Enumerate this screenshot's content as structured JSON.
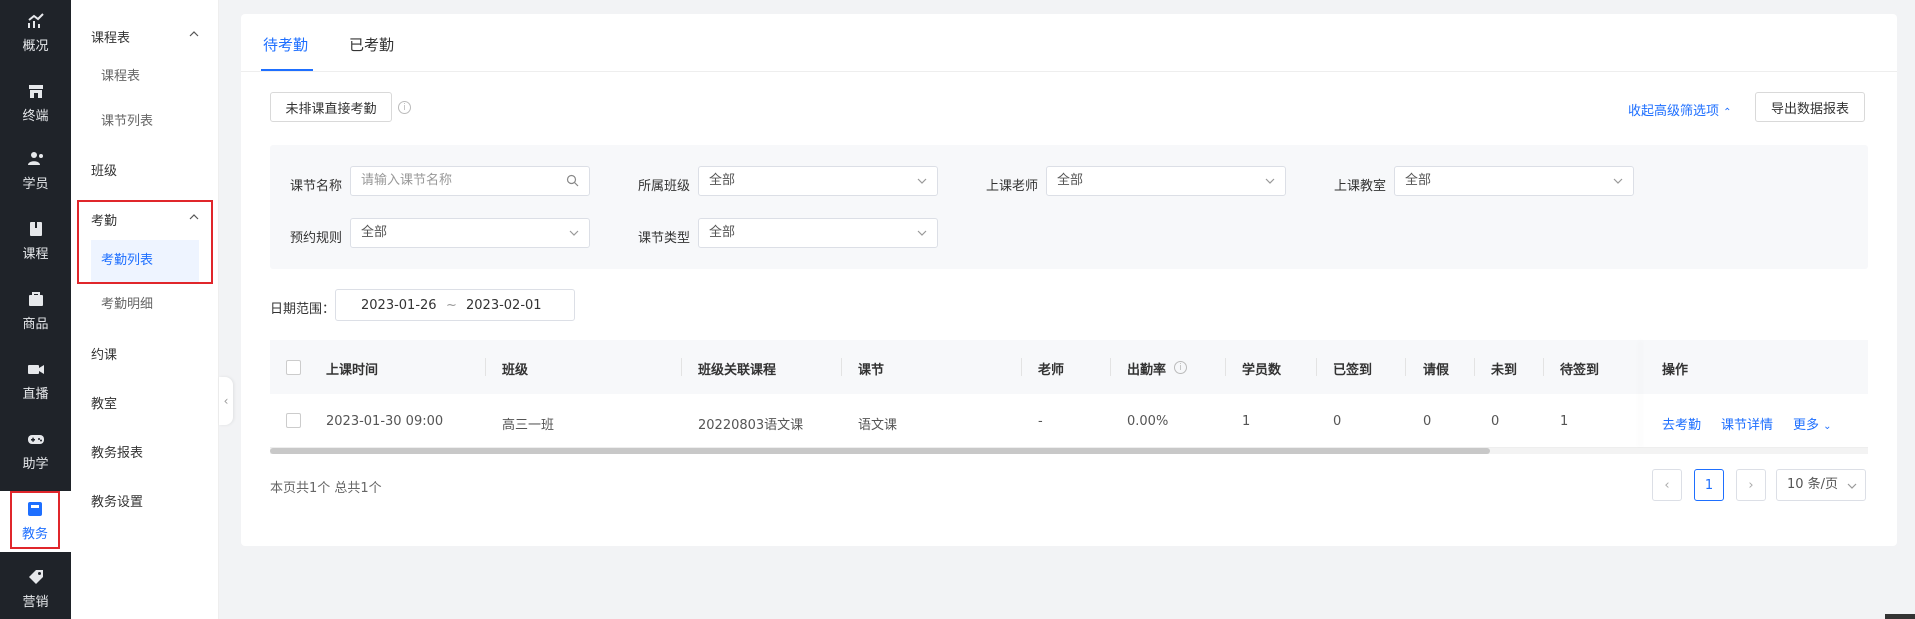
{
  "rail": {
    "items": [
      {
        "label": "概况",
        "icon": "chart-trend-icon"
      },
      {
        "label": "终端",
        "icon": "store-icon"
      },
      {
        "label": "学员",
        "icon": "users-icon"
      },
      {
        "label": "课程",
        "icon": "book-icon"
      },
      {
        "label": "商品",
        "icon": "bag-icon"
      },
      {
        "label": "直播",
        "icon": "video-camera-icon"
      },
      {
        "label": "助学",
        "icon": "gamepad-icon"
      },
      {
        "label": "教务",
        "icon": "calendar-book-icon",
        "active": true
      },
      {
        "label": "营销",
        "icon": "tag-icon"
      }
    ]
  },
  "subnav": {
    "course_group": "课程表",
    "course_items": [
      "课程表",
      "课节列表"
    ],
    "class": "班级",
    "attendance_group": "考勤",
    "attendance_items": [
      "考勤列表",
      "考勤明细"
    ],
    "booking": "约课",
    "classroom": "教室",
    "report": "教务报表",
    "settings": "教务设置"
  },
  "tabs": [
    "待考勤",
    "已考勤"
  ],
  "toolbar": {
    "direct_attendance": "未排课直接考勤",
    "collapse_filters": "收起高级筛选项",
    "export": "导出数据报表"
  },
  "filters": {
    "lesson_name_label": "课节名称",
    "lesson_name_placeholder": "请输入课节名称",
    "class_label": "所属班级",
    "class_value": "全部",
    "teacher_label": "上课老师",
    "teacher_value": "全部",
    "classroom_label": "上课教室",
    "classroom_value": "全部",
    "booking_rule_label": "预约规则",
    "booking_rule_value": "全部",
    "lesson_type_label": "课节类型",
    "lesson_type_value": "全部"
  },
  "date": {
    "label": "日期范围：",
    "start": "2023-01-26",
    "separator": "~",
    "end": "2023-02-01"
  },
  "table": {
    "headers": [
      "上课时间",
      "班级",
      "班级关联课程",
      "课节",
      "老师",
      "出勤率",
      "学员数",
      "已签到",
      "请假",
      "未到",
      "待签到",
      "操作"
    ],
    "rows": [
      {
        "time": "2023-01-30 09:00",
        "class": "高三一班",
        "course": "20220803语文课",
        "lesson": "语文课",
        "teacher": "-",
        "rate": "0.00%",
        "students": "1",
        "signed": "0",
        "leave": "0",
        "absent": "0",
        "pending": "1",
        "actions": [
          "去考勤",
          "课节详情",
          "更多"
        ]
      }
    ]
  },
  "pagination": {
    "summary": "本页共1个 总共1个",
    "current_page": "1",
    "page_size": "10 条/页"
  },
  "colors": {
    "accent": "#1e6fff",
    "highlight_border": "#e0262b",
    "rail_bg": "#1f2329"
  }
}
